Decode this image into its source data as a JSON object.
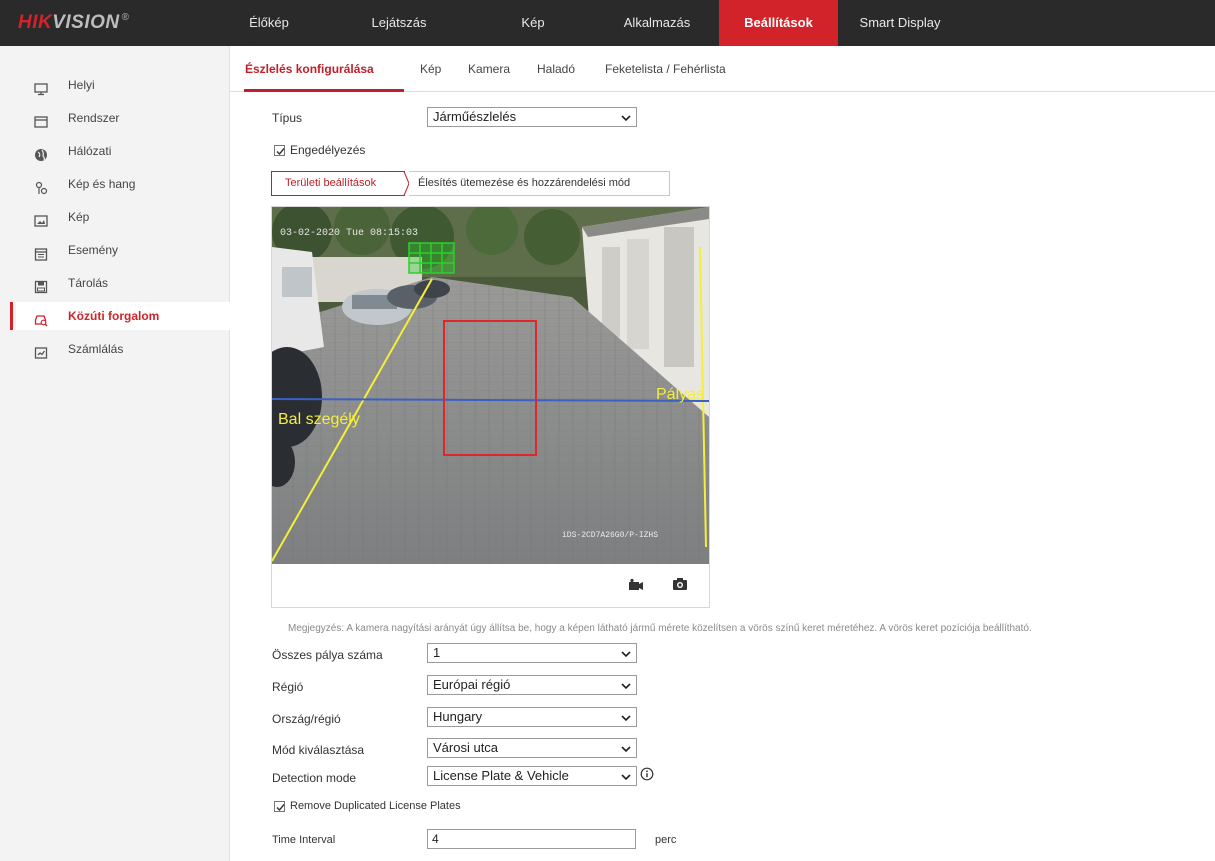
{
  "brand": {
    "hik": "HIK",
    "vision": "VISION",
    "reg": "®"
  },
  "nav": [
    "Élőkép",
    "Lejátszás",
    "Kép",
    "Alkalmazás",
    "Beállítások",
    "Smart Display"
  ],
  "sidebar": {
    "items": [
      {
        "label": "Helyi",
        "icon": "monitor-icon"
      },
      {
        "label": "Rendszer",
        "icon": "system-icon"
      },
      {
        "label": "Hálózati",
        "icon": "globe-icon"
      },
      {
        "label": "Kép és hang",
        "icon": "video-audio-icon"
      },
      {
        "label": "Kép",
        "icon": "image-icon"
      },
      {
        "label": "Esemény",
        "icon": "calendar-icon"
      },
      {
        "label": "Tárolás",
        "icon": "storage-icon"
      },
      {
        "label": "Közúti forgalom",
        "icon": "car-search-icon"
      },
      {
        "label": "Számlálás",
        "icon": "counting-icon"
      }
    ],
    "active_index": 7
  },
  "subtabs": [
    "Észlelés konfigurálása",
    "Kép",
    "Kamera",
    "Haladó",
    "Feketelista / Fehérlista"
  ],
  "form": {
    "type_label": "Típus",
    "type_value": "Járműészlelés",
    "enable_label": "Engedélyezés",
    "enable_checked": true
  },
  "steptabs": [
    "Területi beállítások",
    "Élesítés ütemezése és hozzárendelési mód"
  ],
  "video": {
    "timestamp": "03-02-2020 Tue 08:15:03",
    "left_label": "Bal szegély",
    "right_label": "Pályas",
    "camera_id": "iDS-2CD7A26G0/P-IZHS"
  },
  "note": "Megjegyzés: A kamera nagyítási arányát úgy állítsa be, hogy a képen látható jármű mérete közelítsen a vörös színű keret méretéhez. A vörös keret pozíciója beállítható.",
  "settings": {
    "lanes_label": "Összes pálya száma",
    "lanes_value": "1",
    "region_label": "Régió",
    "region_value": "Európai régió",
    "country_label": "Ország/régió",
    "country_value": "Hungary",
    "mode_label": "Mód kiválasztása",
    "mode_value": "Városi utca",
    "detection_label": "Detection mode",
    "detection_value": "License Plate & Vehicle",
    "dup_label": "Remove Duplicated License Plates",
    "dup_checked": true,
    "interval_label": "Time Interval",
    "interval_value": "4",
    "interval_unit": "perc"
  },
  "colors": {
    "accent": "#d2232a",
    "topbar": "#2a2a2a",
    "sidebar": "#f3f3f3",
    "overlay_yellow": "#f5ef3a",
    "overlay_red": "#e0262a",
    "overlay_green": "#2bd12b",
    "lane_line": "#3a60c8"
  }
}
